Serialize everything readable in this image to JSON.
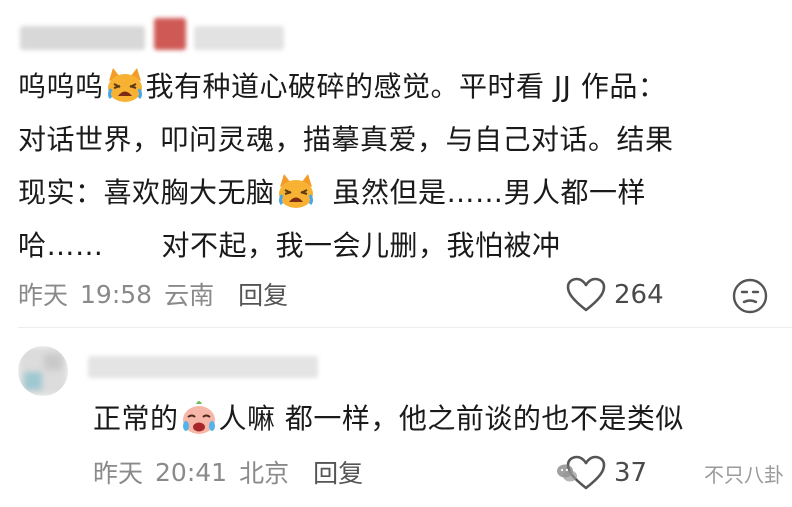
{
  "comment1": {
    "line1_a": "呜呜呜",
    "line1_b": "我有种道心破碎的感觉。平时看 JJ 作品：",
    "line2": "对话世界，叩问灵魂，描摹真爱，与自己对话。结果",
    "line3_a": "现实：喜欢胸大无脑",
    "line3_b": "虽然但是……男人都一样",
    "line4_a": "哈……",
    "line4_b": "对不起，我一会儿删，我怕被冲",
    "date": "昨天",
    "time": "19:58",
    "location": "云南",
    "reply_label": "回复",
    "like_count": "264"
  },
  "comment2": {
    "text_a": "正常的",
    "text_b": "人嘛 都一样，他之前谈的也不是类似",
    "date": "昨天",
    "time": "20:41",
    "location": "北京",
    "reply_label": "回复",
    "like_count": "37"
  },
  "watermark": {
    "text": "不只八卦"
  },
  "icons": {
    "emoji_1": "crying-cat-emoji-icon",
    "emoji_2": "crying-cat-emoji-icon",
    "emoji_3": "crying-baby-emoji-icon",
    "like": "heart-icon",
    "dislike": "neutral-face-icon",
    "watermark": "wechat-icon"
  },
  "colors": {
    "text": "#1a1a1a",
    "meta": "#8a8a8a",
    "accent_orange": "#f5a623",
    "blur_red": "#d9534f"
  }
}
